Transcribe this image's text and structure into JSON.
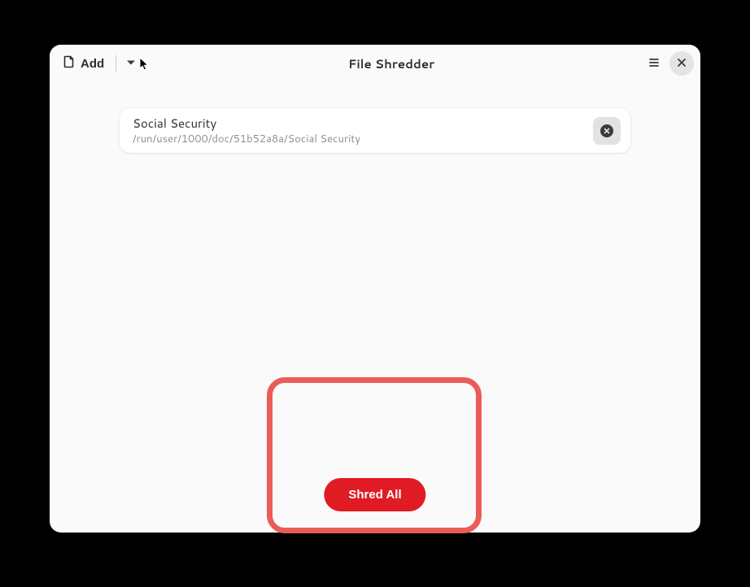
{
  "header": {
    "title": "File Shredder",
    "add_label": "Add"
  },
  "files": [
    {
      "name": "Social Security",
      "path": "/run/user/1000/doc/51b52a8a/Social Security"
    }
  ],
  "actions": {
    "shred_all_label": "Shred All"
  }
}
